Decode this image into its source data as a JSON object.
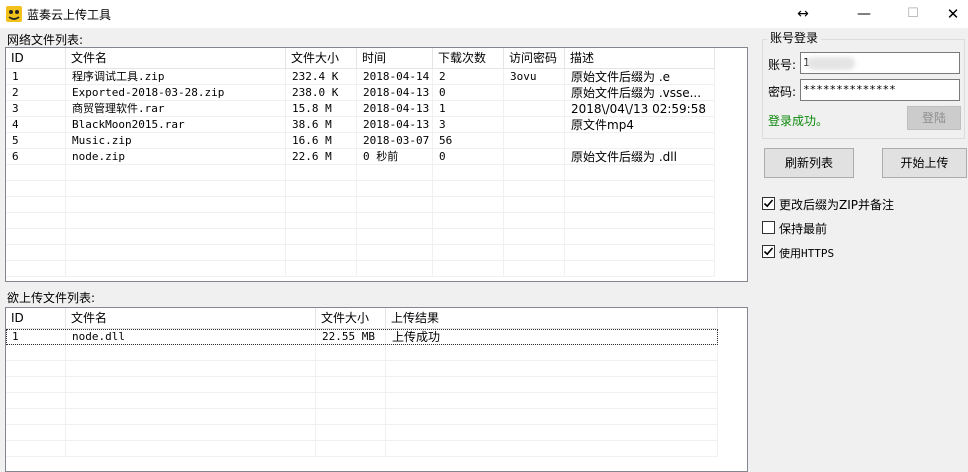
{
  "window": {
    "title": "蓝奏云上传工具",
    "restore_glyph": "↔",
    "min_glyph": "—",
    "max_glyph": "☐",
    "close_glyph": "✕"
  },
  "network_list": {
    "label": "网络文件列表:",
    "columns": [
      "ID",
      "文件名",
      "文件大小",
      "时间",
      "下载次数",
      "访问密码",
      "描述"
    ],
    "rows": [
      [
        "1",
        "程序调试工具.zip",
        "232.4 K",
        "2018-04-14",
        "2",
        "3ovu",
        "原始文件后缀为 .e"
      ],
      [
        "2",
        "Exported-2018-03-28.zip",
        "238.0 K",
        "2018-04-13",
        "0",
        "",
        "原始文件后缀为 .vsse..."
      ],
      [
        "3",
        "商贸管理软件.rar",
        "15.8 M",
        "2018-04-13",
        "1",
        "",
        "2018\\/04\\/13 02:59:58"
      ],
      [
        "4",
        "BlackMoon2015.rar",
        "38.6 M",
        "2018-04-13",
        "3",
        "",
        "原文件mp4"
      ],
      [
        "5",
        "Music.zip",
        "16.6 M",
        "2018-03-07",
        "56",
        "",
        ""
      ],
      [
        "6",
        "node.zip",
        "22.6 M",
        "0 秒前",
        "0",
        "",
        "原始文件后缀为 .dll"
      ]
    ]
  },
  "upload_list": {
    "label": "欲上传文件列表:",
    "columns": [
      "ID",
      "文件名",
      "文件大小",
      "上传结果"
    ],
    "rows": [
      [
        "1",
        "node.dll",
        "22.55 MB",
        "上传成功"
      ]
    ]
  },
  "login": {
    "group_title": "账号登录",
    "account_label": "账号:",
    "account_value": "1",
    "password_label": "密码:",
    "password_value": "**************",
    "status": "登录成功。",
    "login_button": "登陆"
  },
  "actions": {
    "refresh_button": "刷新列表",
    "upload_button": "开始上传"
  },
  "options": [
    {
      "label": "更改后缀为ZIP并备注",
      "checked": true
    },
    {
      "label": "保持最前",
      "checked": false
    },
    {
      "label": "使用HTTPS",
      "checked": true
    }
  ]
}
